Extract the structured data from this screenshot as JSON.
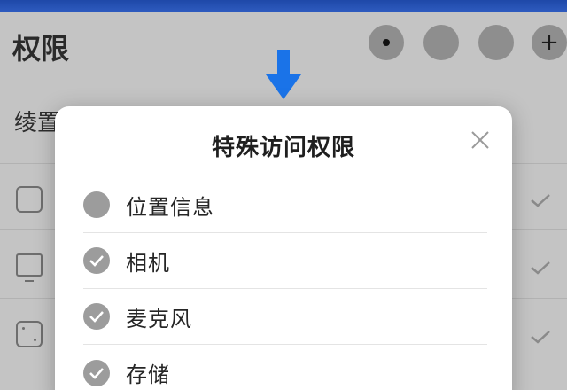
{
  "background": {
    "title": "权限",
    "subtitle": "绫置",
    "header_buttons": [
      {
        "icon": "dot-icon"
      },
      {
        "icon": "circle-icon"
      },
      {
        "icon": "circle-icon"
      },
      {
        "icon": "plus-icon",
        "glyph": "+"
      }
    ]
  },
  "modal": {
    "title": "特殊访问权限",
    "close_icon": "close-icon",
    "items": [
      {
        "label": "位置信息",
        "checked": false
      },
      {
        "label": "相机",
        "checked": true
      },
      {
        "label": "麦克风",
        "checked": true
      },
      {
        "label": "存储",
        "checked": true
      }
    ]
  },
  "colors": {
    "top_bar": "#2f5cc0",
    "arrow": "#1a73e8",
    "overlay": "#c4c4c4",
    "radio": "#9c9c9c"
  }
}
